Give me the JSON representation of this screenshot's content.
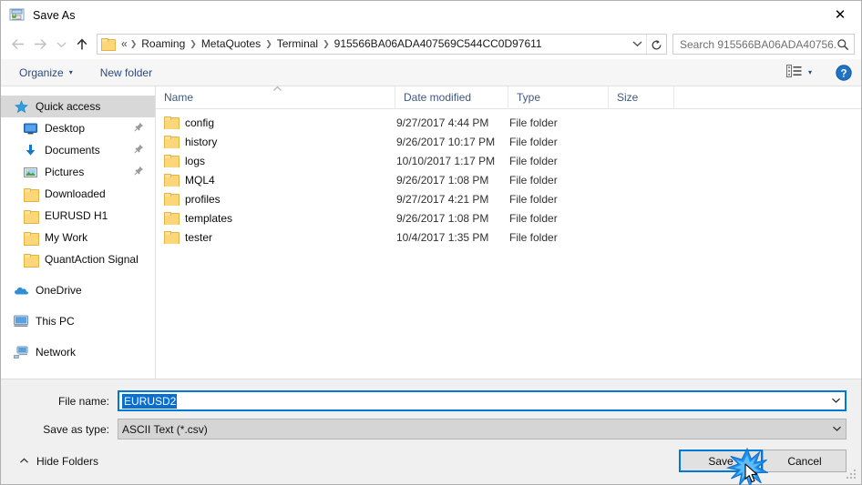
{
  "window": {
    "title": "Save As",
    "title_icon": "save-as-icon",
    "close_icon": "close-icon"
  },
  "nav": {
    "back_icon": "arrow-left-icon",
    "forward_icon": "arrow-right-icon",
    "recent_icon": "chevron-down-icon",
    "up_icon": "arrow-up-icon",
    "address": {
      "folder_icon": "folder-icon",
      "lead": "«",
      "crumbs": [
        "Roaming",
        "MetaQuotes",
        "Terminal",
        "915566BA06ADA407569C544CC0D97611"
      ],
      "separator": "❯",
      "dropdown_icon": "chevron-down-icon",
      "refresh_icon": "refresh-icon"
    },
    "search": {
      "placeholder": "Search 915566BA06ADA40756...",
      "icon": "search-icon"
    }
  },
  "toolbar": {
    "organize_label": "Organize",
    "organize_caret": "▾",
    "new_folder_label": "New folder",
    "view_icon": "list-view-icon",
    "view_caret": "▾",
    "help_icon": "help-icon",
    "help_glyph": "?"
  },
  "sidebar": {
    "items": [
      {
        "label": "Quick access",
        "icon": "star-icon",
        "level": 0,
        "selected": true,
        "pinned": false,
        "group": false
      },
      {
        "label": "Desktop",
        "icon": "desktop-icon",
        "level": 1,
        "selected": false,
        "pinned": true,
        "group": false
      },
      {
        "label": "Documents",
        "icon": "download-arrow-icon",
        "level": 1,
        "selected": false,
        "pinned": true,
        "group": false
      },
      {
        "label": "Pictures",
        "icon": "pictures-icon",
        "level": 1,
        "selected": false,
        "pinned": true,
        "group": false
      },
      {
        "label": "Downloaded",
        "icon": "folder-icon",
        "level": 1,
        "selected": false,
        "pinned": false,
        "group": false
      },
      {
        "label": "EURUSD H1",
        "icon": "folder-icon",
        "level": 1,
        "selected": false,
        "pinned": false,
        "group": false
      },
      {
        "label": "My Work",
        "icon": "folder-icon",
        "level": 1,
        "selected": false,
        "pinned": false,
        "group": false
      },
      {
        "label": "QuantAction Signal",
        "icon": "folder-icon",
        "level": 1,
        "selected": false,
        "pinned": false,
        "group": false
      },
      {
        "label": "OneDrive",
        "icon": "cloud-icon",
        "level": 0,
        "selected": false,
        "pinned": false,
        "group": true
      },
      {
        "label": "This PC",
        "icon": "monitor-icon",
        "level": 0,
        "selected": false,
        "pinned": false,
        "group": true
      },
      {
        "label": "Network",
        "icon": "network-icon",
        "level": 0,
        "selected": false,
        "pinned": false,
        "group": true
      }
    ],
    "pin_glyph": "📌"
  },
  "filelist": {
    "columns": [
      "Name",
      "Date modified",
      "Type",
      "Size"
    ],
    "sort_caret": "▲",
    "rows": [
      {
        "name": "config",
        "date": "9/27/2017 4:44 PM",
        "type": "File folder",
        "size": ""
      },
      {
        "name": "history",
        "date": "9/26/2017 10:17 PM",
        "type": "File folder",
        "size": ""
      },
      {
        "name": "logs",
        "date": "10/10/2017 1:17 PM",
        "type": "File folder",
        "size": ""
      },
      {
        "name": "MQL4",
        "date": "9/26/2017 1:08 PM",
        "type": "File folder",
        "size": ""
      },
      {
        "name": "profiles",
        "date": "9/27/2017 4:21 PM",
        "type": "File folder",
        "size": ""
      },
      {
        "name": "templates",
        "date": "9/26/2017 1:08 PM",
        "type": "File folder",
        "size": ""
      },
      {
        "name": "tester",
        "date": "10/4/2017 1:35 PM",
        "type": "File folder",
        "size": ""
      }
    ]
  },
  "form": {
    "filename_label": "File name:",
    "filename_value": "EURUSD2",
    "filetype_label": "Save as type:",
    "filetype_value": "ASCII Text (*.csv)",
    "dropdown_icon": "chevron-down-icon"
  },
  "footer": {
    "hide_folders_label": "Hide Folders",
    "hide_folders_caret": "^",
    "save_label": "Save",
    "cancel_label": "Cancel",
    "resize_grip": "resize-grip-icon"
  },
  "colors": {
    "accent": "#0078d7",
    "selection": "#0a6ed1",
    "folder_yellow": "#fcd77a",
    "link_blue": "#2b4b7e",
    "header_blue": "#41577e"
  }
}
